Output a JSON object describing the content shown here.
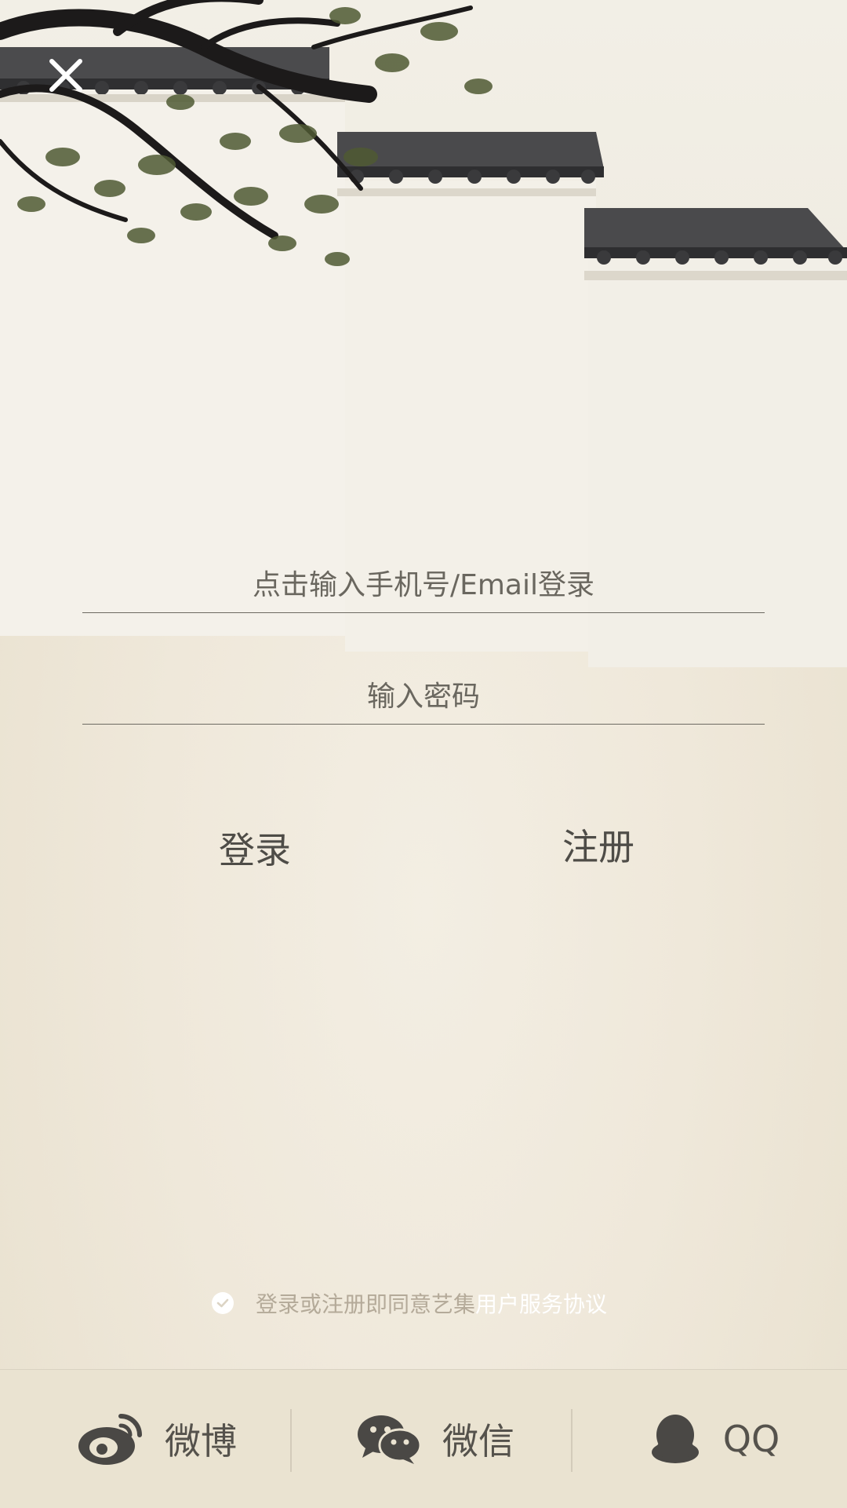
{
  "icons": {
    "close": "close-icon",
    "check": "check-icon",
    "weibo": "weibo-icon",
    "wechat": "wechat-icon",
    "qq": "qq-icon"
  },
  "login_form": {
    "account_placeholder": "点击输入手机号/Email登录",
    "password_placeholder": "输入密码",
    "login_label": "登录",
    "register_label": "注册"
  },
  "agreement": {
    "prefix": "登录或注册即同意艺集",
    "link": "用户服务协议"
  },
  "social_login": [
    {
      "label": "微博"
    },
    {
      "label": "微信"
    },
    {
      "label": "QQ"
    }
  ],
  "colors": {
    "background": "#efe8da",
    "text": "#4e4c47",
    "link": "#ffffff",
    "muted": "#b4aa99"
  }
}
